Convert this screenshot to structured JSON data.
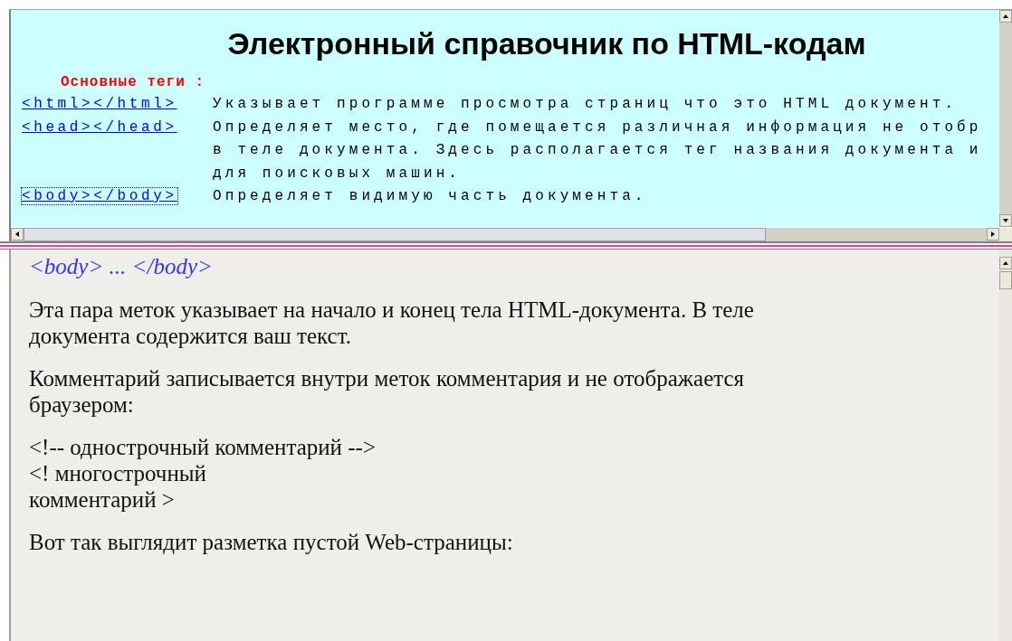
{
  "top_frame": {
    "title": "Электронный справочник по HTML-кодам",
    "section_label": "Основные теги :",
    "entries": [
      {
        "tag": "<html></html>",
        "focused": false,
        "lines": [
          "Указывает программе просмотра страниц что это HTML документ."
        ]
      },
      {
        "tag": "<head></head>",
        "focused": false,
        "lines": [
          "Определяет место, где помещается различная информация не отобр",
          "в теле документа. Здесь располагается тег названия документа и",
          "для поисковых машин."
        ]
      },
      {
        "tag": "<body></body>",
        "focused": true,
        "lines": [
          "Определяет видимую часть документа."
        ]
      }
    ]
  },
  "bottom_frame": {
    "heading": "<body> ... </body>",
    "paragraphs": [
      {
        "lines": [
          "Эта пара меток указывает на начало и конец тела HTML-документа. В теле",
          "документа содержится ваш текст."
        ]
      },
      {
        "lines": [
          "Комментарий записывается внутри меток комментария и не отображается",
          "браузером:"
        ]
      },
      {
        "lines": [
          "<!-- однострочный комментарий -->",
          "<! многострочный",
          "комментарий >"
        ]
      },
      {
        "lines": [
          "Вот так выглядит разметка пустой Web-страницы:"
        ]
      }
    ]
  }
}
